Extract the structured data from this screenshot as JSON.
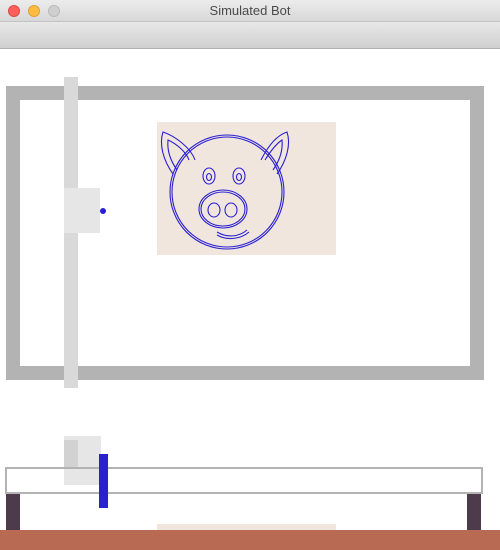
{
  "window": {
    "title": "Simulated Bot"
  },
  "colors": {
    "frame": "#b3b3b3",
    "rail": "#d9d9d9",
    "carriage": "#e6e6e6",
    "pen": "#2a1fd1",
    "paper": "#f0e6de",
    "table": "#b86a53",
    "legs": "#4d3a4a"
  },
  "drawing": {
    "subject": "pig-face",
    "stroke_color": "#2a1fd1"
  }
}
